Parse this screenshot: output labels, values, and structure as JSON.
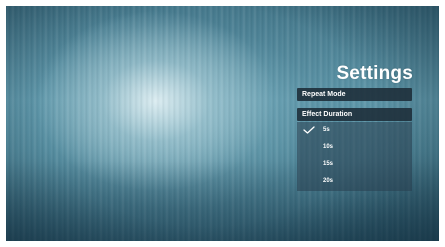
{
  "header": {
    "title": "Settings"
  },
  "menu": {
    "repeat_mode_label": "Repeat Mode",
    "effect_duration_label": "Effect Duration"
  },
  "effect_duration_options": [
    {
      "label": "5s",
      "selected": true
    },
    {
      "label": "10s",
      "selected": false
    },
    {
      "label": "15s",
      "selected": false
    },
    {
      "label": "20s",
      "selected": false
    }
  ],
  "icons": {
    "selected_marker": "check-icon"
  },
  "colors": {
    "menu_item_bg": "#1c2c38",
    "text": "#ffffff"
  }
}
